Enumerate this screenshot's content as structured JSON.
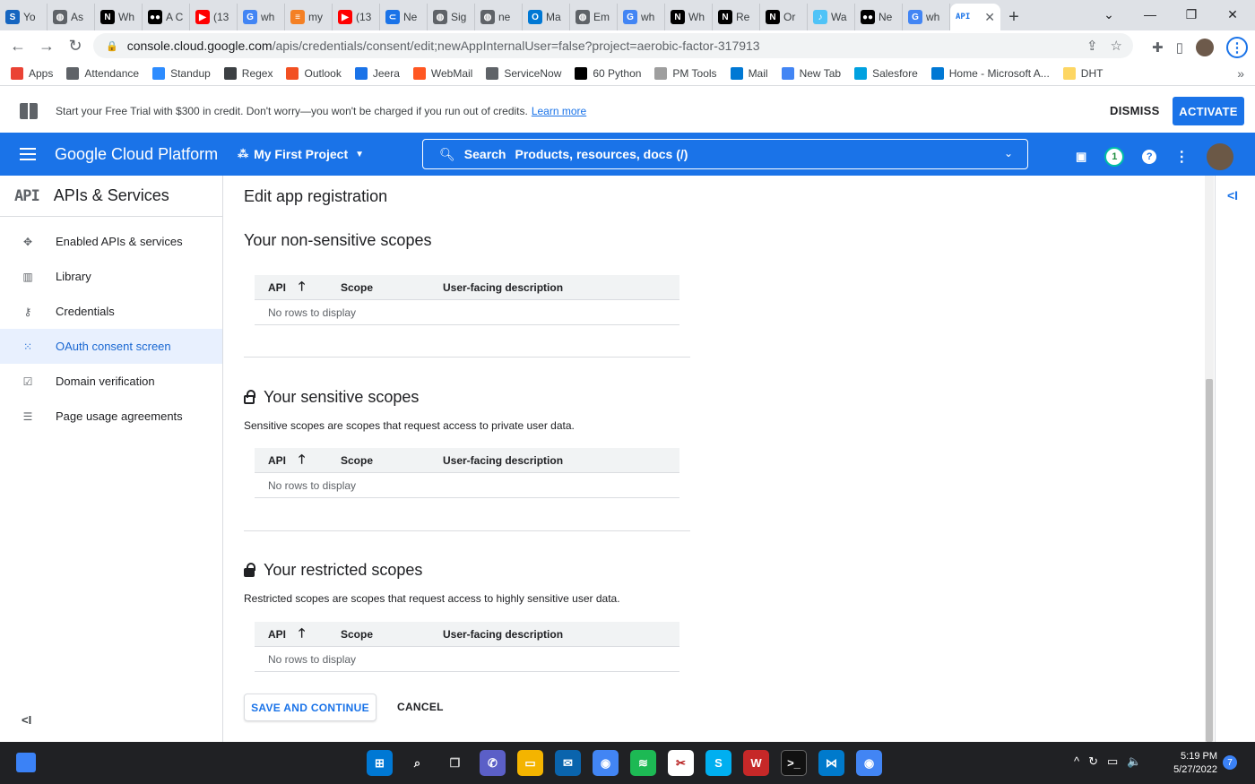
{
  "browser": {
    "tabs": [
      {
        "label": "Yo",
        "icon": "s-icon",
        "color": "#1565c0",
        "glyph": "S"
      },
      {
        "label": "As",
        "icon": "globe-icon",
        "color": "#5f6368",
        "glyph": "◍"
      },
      {
        "label": "Wh",
        "icon": "notion-icon",
        "color": "#000000",
        "glyph": "N"
      },
      {
        "label": "A C",
        "icon": "medium-icon",
        "color": "#000000",
        "glyph": "●●"
      },
      {
        "label": "(13",
        "icon": "youtube-icon",
        "color": "#ff0000",
        "glyph": "▶"
      },
      {
        "label": "wh",
        "icon": "google-icon",
        "color": "#4285f4",
        "glyph": "G"
      },
      {
        "label": "my",
        "icon": "stackoverflow-icon",
        "color": "#f48024",
        "glyph": "≡"
      },
      {
        "label": "(13",
        "icon": "youtube-icon",
        "color": "#ff0000",
        "glyph": "▶"
      },
      {
        "label": "Ne",
        "icon": "bookmark-icon",
        "color": "#1a73e8",
        "glyph": "⊂"
      },
      {
        "label": "Sig",
        "icon": "globe-icon",
        "color": "#5f6368",
        "glyph": "◍"
      },
      {
        "label": "ne",
        "icon": "globe-icon",
        "color": "#5f6368",
        "glyph": "◍"
      },
      {
        "label": "Ma",
        "icon": "outlook-icon",
        "color": "#0078d4",
        "glyph": "O"
      },
      {
        "label": "Em",
        "icon": "globe-icon",
        "color": "#5f6368",
        "glyph": "◍"
      },
      {
        "label": "wh",
        "icon": "google-icon",
        "color": "#4285f4",
        "glyph": "G"
      },
      {
        "label": "Wh",
        "icon": "notion-icon",
        "color": "#000000",
        "glyph": "N"
      },
      {
        "label": "Re",
        "icon": "notion-icon",
        "color": "#000000",
        "glyph": "N"
      },
      {
        "label": "Or",
        "icon": "notion-icon",
        "color": "#000000",
        "glyph": "N"
      },
      {
        "label": "Wa",
        "icon": "doc-icon",
        "color": "#4fc3f7",
        "glyph": "♪"
      },
      {
        "label": "Ne",
        "icon": "medium-icon",
        "color": "#000000",
        "glyph": "●●"
      },
      {
        "label": "wh",
        "icon": "google-icon",
        "color": "#4285f4",
        "glyph": "G"
      }
    ],
    "active_tab_icon_text": "API",
    "url_host": "console.cloud.google.com",
    "url_path": "/apis/credentials/consent/edit;newAppInternalUser=false?project=aerobic-factor-317913",
    "bookmarks": [
      {
        "label": "Apps",
        "color": "#ea4335"
      },
      {
        "label": "Attendance",
        "color": "#5f6368"
      },
      {
        "label": "Standup",
        "color": "#2d8cff"
      },
      {
        "label": "Regex",
        "color": "#3c4043"
      },
      {
        "label": "Outlook",
        "color": "#f25022"
      },
      {
        "label": "Jeera",
        "color": "#1a73e8"
      },
      {
        "label": "WebMail",
        "color": "#ff5722"
      },
      {
        "label": "ServiceNow",
        "color": "#5f6368"
      },
      {
        "label": "60 Python",
        "color": "#000000"
      },
      {
        "label": "PM Tools",
        "color": "#9e9e9e"
      },
      {
        "label": "Mail",
        "color": "#0078d4"
      },
      {
        "label": "New Tab",
        "color": "#4285f4"
      },
      {
        "label": "Salesfore",
        "color": "#00a1e0"
      },
      {
        "label": "Home - Microsoft A...",
        "color": "#0078d4"
      },
      {
        "label": "DHT",
        "color": "#fdd663"
      }
    ]
  },
  "banner": {
    "message": "Start your Free Trial with $300 in credit. Don't worry—you won't be charged if you run out of credits.",
    "link": "Learn more",
    "dismiss": "DISMISS",
    "activate": "ACTIVATE"
  },
  "gcp": {
    "brand": "Google Cloud Platform",
    "project": "My First Project",
    "search_label": "Search",
    "search_placeholder": "Products, resources, docs (/)",
    "notification_count": "1",
    "accent": "#1a73e8"
  },
  "nav": {
    "logo": "API",
    "title": "APIs & Services",
    "items": [
      {
        "label": "Enabled APIs & services",
        "icon": "enabled-apis-icon",
        "glyph": "✥",
        "active": false
      },
      {
        "label": "Library",
        "icon": "library-icon",
        "glyph": "▥",
        "active": false
      },
      {
        "label": "Credentials",
        "icon": "key-icon",
        "glyph": "⚷",
        "active": false
      },
      {
        "label": "OAuth consent screen",
        "icon": "oauth-icon",
        "glyph": "⁙",
        "active": true
      },
      {
        "label": "Domain verification",
        "icon": "checkbox-icon",
        "glyph": "☑",
        "active": false
      },
      {
        "label": "Page usage agreements",
        "icon": "settings-list-icon",
        "glyph": "☰",
        "active": false
      }
    ]
  },
  "main": {
    "page_title": "Edit app registration",
    "table_headers": {
      "api": "API",
      "scope": "Scope",
      "description": "User-facing description"
    },
    "empty_text": "No rows to display",
    "sections": [
      {
        "title": "Your non-sensitive scopes",
        "description": ""
      },
      {
        "title": "Your sensitive scopes",
        "description": "Sensitive scopes are scopes that request access to private user data."
      },
      {
        "title": "Your restricted scopes",
        "description": "Restricted scopes are scopes that request access to highly sensitive user data."
      }
    ],
    "save_button": "SAVE AND CONTINUE",
    "cancel_button": "CANCEL"
  },
  "taskbar": {
    "time": "5:19 PM",
    "date": "5/27/2022",
    "notification_badge": "7"
  }
}
